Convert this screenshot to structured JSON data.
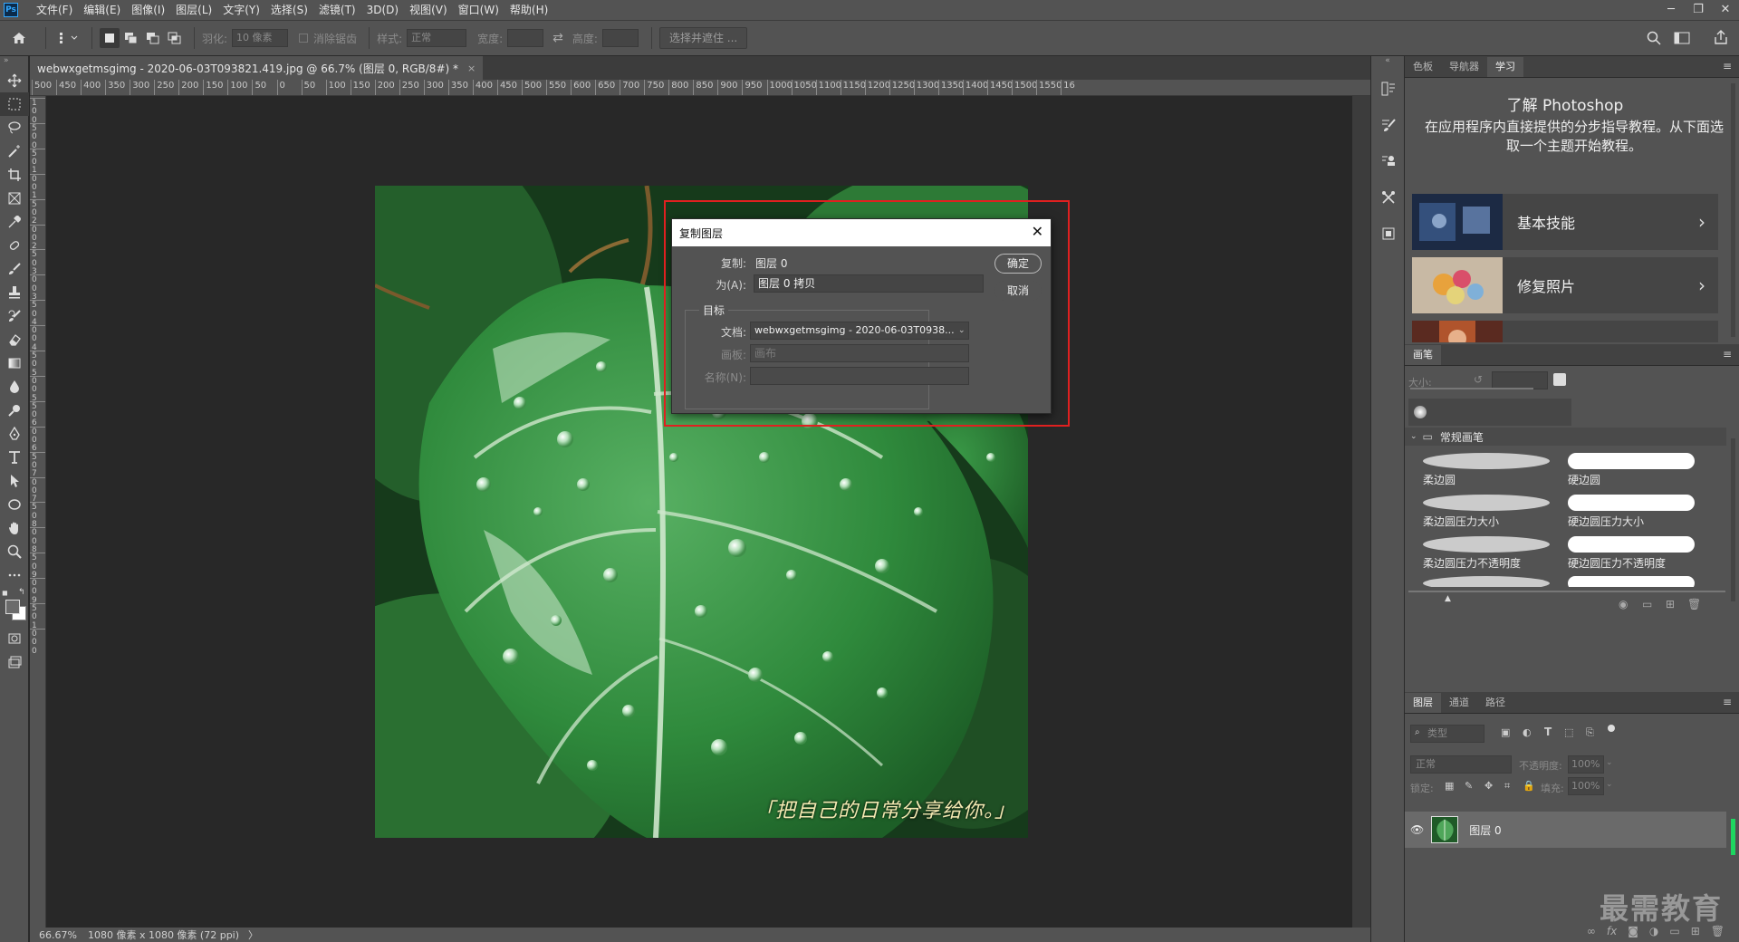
{
  "menubar": {
    "logo": "Ps",
    "items": [
      "文件(F)",
      "编辑(E)",
      "图像(I)",
      "图层(L)",
      "文字(Y)",
      "选择(S)",
      "滤镜(T)",
      "3D(D)",
      "视图(V)",
      "窗口(W)",
      "帮助(H)"
    ],
    "window_controls": [
      "─",
      "❐",
      "✕"
    ]
  },
  "options": {
    "feather_label": "羽化:",
    "feather_value": "10 像素",
    "antialias_label": "消除锯齿",
    "style_label": "样式:",
    "style_value": "正常",
    "width_label": "宽度:",
    "height_label": "高度:",
    "select_mask_button": "选择并遮住 ..."
  },
  "document": {
    "tab_title": "webwxgetmsgimg - 2020-06-03T093821.419.jpg @ 66.7% (图层 0, RGB/8#) *",
    "tab_close": "×",
    "caption": "「把自己的日常分享给你。」"
  },
  "ruler_top_labels": [
    "500",
    "450",
    "400",
    "350",
    "300",
    "250",
    "200",
    "150",
    "100",
    "50",
    "0",
    "50",
    "100",
    "150",
    "200",
    "250",
    "300",
    "350",
    "400",
    "450",
    "500",
    "550",
    "600",
    "650",
    "700",
    "750",
    "800",
    "850",
    "900",
    "950",
    "1000",
    "1050",
    "1100",
    "1150",
    "1200",
    "1250",
    "1300",
    "1350",
    "1400",
    "1450",
    "1500",
    "1550",
    "16"
  ],
  "ruler_left_labels": [
    "1",
    "0",
    "0",
    "5",
    "0",
    "0",
    "5",
    "0",
    "1",
    "0",
    "0",
    "1",
    "5",
    "0",
    "2",
    "0",
    "0",
    "2",
    "5",
    "0",
    "3",
    "0",
    "0",
    "3",
    "5",
    "0",
    "4",
    "0",
    "0",
    "4",
    "5",
    "0",
    "5",
    "0",
    "0",
    "5",
    "5",
    "0",
    "6",
    "0",
    "0",
    "6",
    "5",
    "0",
    "7",
    "0",
    "0",
    "7",
    "5",
    "0",
    "8",
    "0",
    "0",
    "8",
    "5",
    "0",
    "9",
    "0",
    "0",
    "9",
    "5",
    "0",
    "1",
    "0",
    "0",
    "0"
  ],
  "status": {
    "zoom": "66.67%",
    "doc_size": "1080 像素 x 1080 像素 (72 ppi)",
    "arrow": "〉"
  },
  "dialog": {
    "title": "复制图层",
    "close": "✕",
    "duplicate_label": "复制:",
    "duplicate_value": "图层 0",
    "as_label": "为(A):",
    "as_value": "图层 0 拷贝",
    "ok_button": "确定",
    "cancel_button": "取消",
    "destination_label": "目标",
    "document_label": "文档:",
    "document_value": "webwxgetmsgimg - 2020-06-03T0938...",
    "artboard_label": "画板:",
    "artboard_value": "画布",
    "name_label": "名称(N):",
    "name_value": ""
  },
  "learn": {
    "tabs": [
      "色板",
      "导航器",
      "学习"
    ],
    "active_tab": "学习",
    "title": "了解 Photoshop",
    "description": "在应用程序内直接提供的分步指导教程。从下面选取一个主题开始教程。",
    "cards": [
      "基本技能",
      "修复照片",
      ""
    ]
  },
  "brush": {
    "tab": "画笔",
    "size_label": "大小:",
    "group_name": "常规画笔",
    "brushes": [
      "柔边圆",
      "硬边圆",
      "柔边圆压力大小",
      "硬边圆压力大小",
      "柔边圆压力不透明度",
      "硬边圆压力不透明度"
    ]
  },
  "layers": {
    "tabs": [
      "图层",
      "通道",
      "路径"
    ],
    "active_tab": "图层",
    "filter_placeholder": "类型",
    "blend_mode": "正常",
    "opacity_label": "不透明度:",
    "opacity_value": "100%",
    "lock_label": "锁定:",
    "fill_label": "填充:",
    "fill_value": "100%",
    "layer_name": "图层 0"
  },
  "watermark": "最需教育",
  "colors": {
    "highlight": "#e02020",
    "panel_bg": "#535353",
    "canvas_bg": "#282828"
  }
}
